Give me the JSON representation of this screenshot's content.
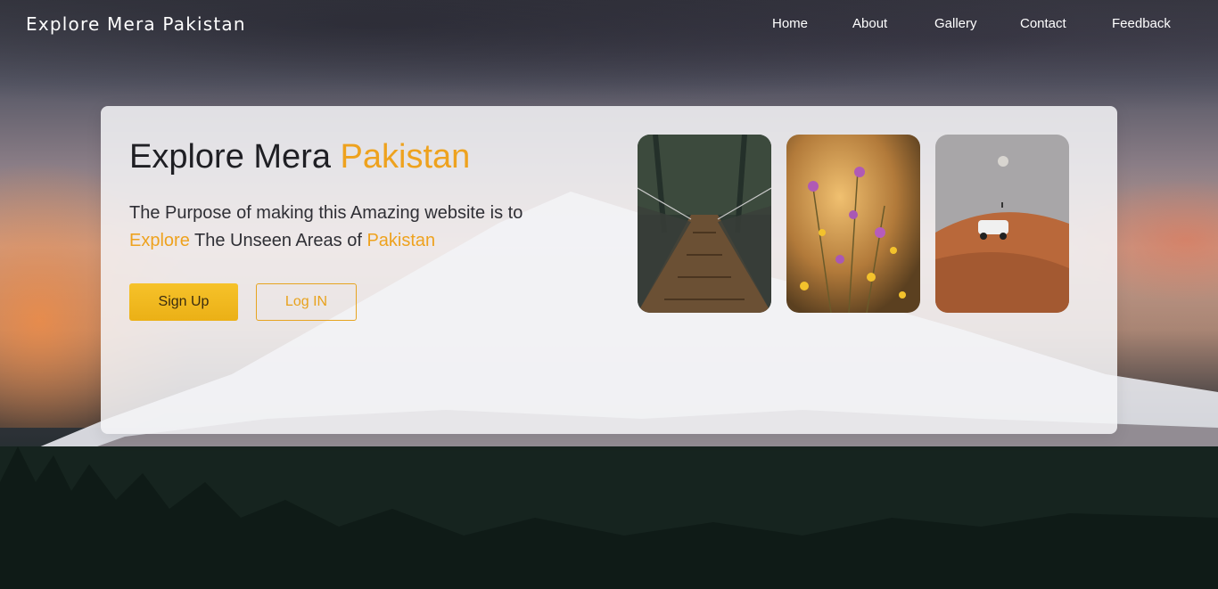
{
  "header": {
    "brand": "Explore Mera Pakistan",
    "nav": [
      "Home",
      "About",
      "Gallery",
      "Contact",
      "Feedback"
    ]
  },
  "hero": {
    "title_main": "Explore Mera ",
    "title_accent": "Pakistan",
    "desc_part1": "The Purpose of making this Amazing website is to",
    "desc_accent1": "Explore",
    "desc_part2": " The Unseen Areas of ",
    "desc_accent2": "Pakistan",
    "signup_label": "Sign Up",
    "login_label": "Log IN"
  },
  "gallery": [
    {
      "subject": "suspension-bridge-forest"
    },
    {
      "subject": "wildflowers"
    },
    {
      "subject": "desert-jeep"
    }
  ],
  "colors": {
    "accent": "#eea21e",
    "button_fill": "#f4bd22",
    "text_dark": "#1f1f24"
  }
}
